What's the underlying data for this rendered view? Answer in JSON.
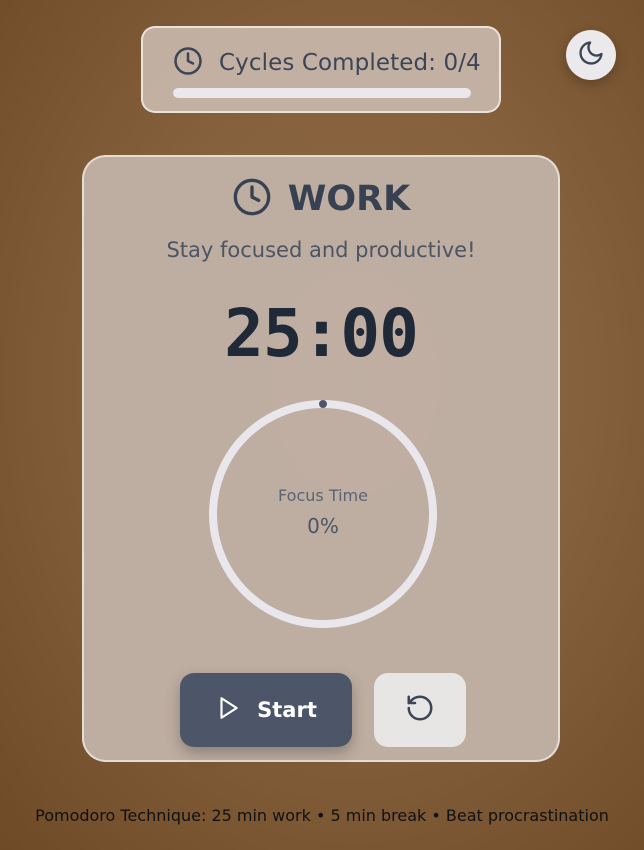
{
  "cycles": {
    "label": "Cycles Completed: 0/4",
    "completed": 0,
    "total": 4,
    "icon": "clock-icon"
  },
  "theme_toggle": {
    "icon": "moon-icon"
  },
  "session": {
    "mode_icon": "clock-icon",
    "mode": "WORK",
    "subtitle": "Stay focused and productive!",
    "time": "25:00",
    "ring_label": "Focus Time",
    "ring_percent": "0%",
    "progress_fraction": 0
  },
  "controls": {
    "start_label": "Start",
    "start_icon": "play-icon",
    "reset_icon": "reset-icon"
  },
  "footer": "Pomodoro Technique: 25 min work • 5 min break • Beat procrastination",
  "colors": {
    "accent": "#4d5668",
    "ring": "#e9e6ec",
    "background": "#86613d"
  }
}
